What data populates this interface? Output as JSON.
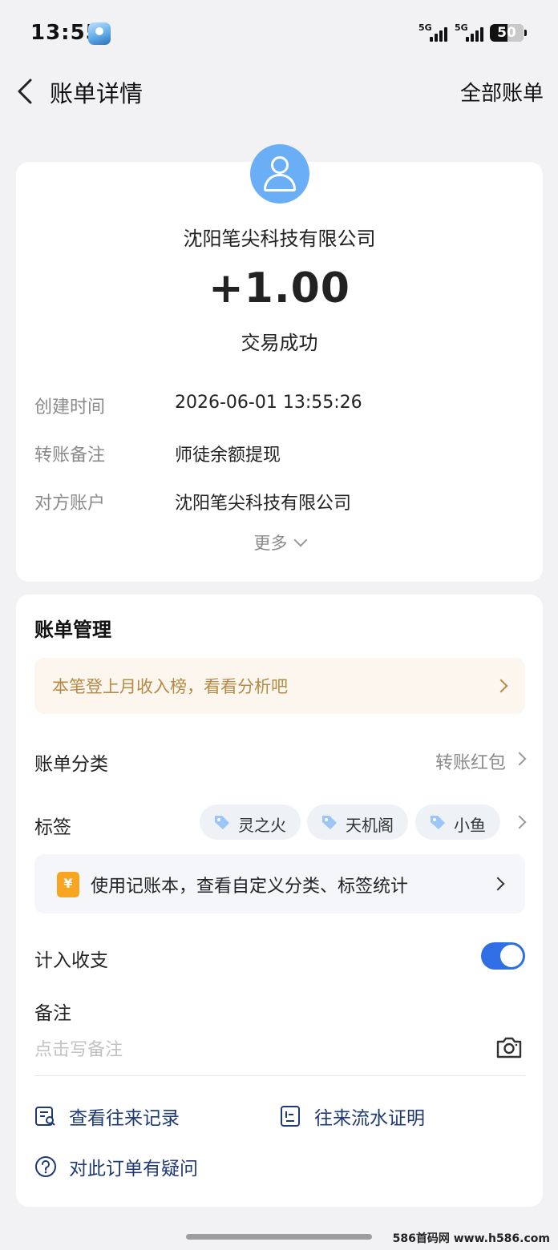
{
  "status_bar": {
    "time": "13:55",
    "signal1": "5G",
    "signal2": "5G",
    "battery": "50"
  },
  "header": {
    "title": "账单详情",
    "right_link": "全部账单"
  },
  "transaction": {
    "payer": "沈阳笔尖科技有限公司",
    "amount": "+1.00",
    "status": "交易成功",
    "details": [
      {
        "label": "创建时间",
        "value": "2026-06-01 13:55:26"
      },
      {
        "label": "转账备注",
        "value": "师徒余额提现"
      },
      {
        "label": "对方账户",
        "value": "沈阳笔尖科技有限公司"
      }
    ],
    "more_label": "更多"
  },
  "manage": {
    "title": "账单管理",
    "tip_banner": "本笔登上月收入榜，看看分析吧",
    "category_label": "账单分类",
    "category_value": "转账红包",
    "tags_label": "标签",
    "tags": [
      "灵之火",
      "天机阁",
      "小鱼"
    ],
    "ledger_icon": "¥",
    "ledger_banner": "使用记账本，查看自定义分类、标签统计",
    "include_label": "计入收支",
    "include_enabled": true,
    "note_label": "备注",
    "note_placeholder": "点击写备注",
    "actions": {
      "history": "查看往来记录",
      "proof": "往来流水证明",
      "question": "对此订单有疑问"
    }
  },
  "watermark": "586首码网 www.h586.com",
  "colors": {
    "accent": "#2f6ee5",
    "avatar": "#6aaef6",
    "tip_text": "#b58a45",
    "action_text": "#1f3a73"
  }
}
